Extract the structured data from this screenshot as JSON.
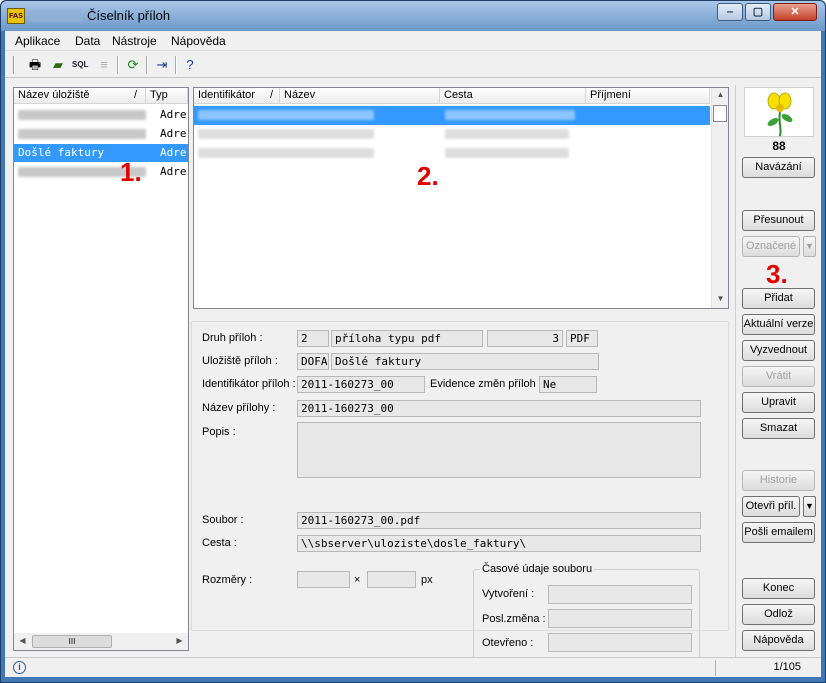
{
  "window": {
    "title": "Číselník příloh",
    "logo_text": "FAS",
    "minimize": "‒",
    "maximize": "▢",
    "close": "✕"
  },
  "menu": [
    "Aplikace",
    "Data",
    "Nástroje",
    "Nápověda"
  ],
  "toolbar": {
    "icons": [
      "printer-icon",
      "export-icon",
      "sql-icon",
      "filter-icon",
      "refresh-icon",
      "exit-icon",
      "help-icon"
    ],
    "sql_label": "SQL"
  },
  "storage_list": {
    "columns": [
      "Název úložiště",
      "Typ"
    ],
    "sort_marker": "/",
    "rows": [
      {
        "name": "",
        "type": "Adre",
        "blurred": true
      },
      {
        "name": "",
        "type": "Adre",
        "blurred": true
      },
      {
        "name": "Došlé faktury",
        "type": "Adre",
        "blurred": false,
        "selected": true
      },
      {
        "name": "",
        "type": "Adre",
        "blurred": true
      }
    ],
    "hscroll_thumb": "III"
  },
  "attachments_grid": {
    "columns": [
      "Identifikátor",
      "Název",
      "Cesta",
      "Příjmení"
    ],
    "sort_marker": "/"
  },
  "markers": {
    "m1": "1.",
    "m2": "2.",
    "m3": "3."
  },
  "form": {
    "druh_label": "Druh příloh :",
    "druh_code": "2",
    "druh_name": "příloha typu pdf",
    "druh_num": "3",
    "druh_ext": "PDF",
    "uloziste_label": "Uložiště příloh :",
    "uloziste_code": "DOFA",
    "uloziste_name": "Došlé faktury",
    "ident_label": "Identifikátor příloh :",
    "ident_value": "2011-160273_00",
    "evidence_label": "Evidence změn příloh :",
    "evidence_value": "Ne",
    "nazev_label": "Název přílohy :",
    "nazev_value": "2011-160273_00",
    "popis_label": "Popis :",
    "popis_value": "",
    "soubor_label": "Soubor :",
    "soubor_value": "2011-160273_00.pdf",
    "cesta_label": "Cesta :",
    "cesta_value": "\\\\sbserver\\uloziste\\dosle_faktury\\",
    "rozmery_label": "Rozměry :",
    "rozmery_x": "×",
    "rozmery_unit": "px",
    "cas_group": "Časové údaje souboru",
    "vytvoreni_label": "Vytvoření :",
    "posl_label": "Posl.změna :",
    "otevreno_label": "Otevřeno :"
  },
  "right": {
    "count": "88",
    "buttons": {
      "navazani": "Navázání",
      "presunout": "Přesunout",
      "oznacene": "Označené",
      "pridat": "Přidat",
      "aktualni": "Aktuální verze",
      "vyzvednout": "Vyzvednout",
      "vratit": "Vrátit",
      "upravit": "Upravit",
      "smazat": "Smazat",
      "historie": "Historie",
      "otevri": "Otevři příl.",
      "posli": "Pošli emailem",
      "konec": "Konec",
      "odloz": "Odlož",
      "napoveda": "Nápověda"
    }
  },
  "status": {
    "info_icon": "i",
    "position": "1/105"
  }
}
